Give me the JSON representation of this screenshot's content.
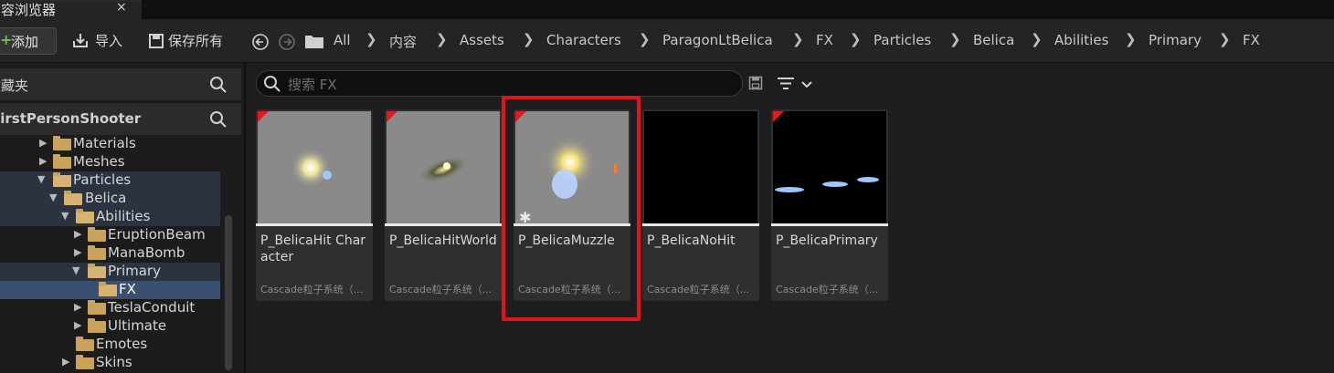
{
  "tab": {
    "title": "内容浏览器",
    "close": "×"
  },
  "toolbar": {
    "add_label": "添加",
    "import_label": "导入",
    "save_all_label": "保存所有"
  },
  "breadcrumbs": [
    "All",
    "内容",
    "Assets",
    "Characters",
    "ParagonLtBelica",
    "FX",
    "Particles",
    "Belica",
    "Abilities",
    "Primary",
    "FX"
  ],
  "left_panel": {
    "favorites_label": "收藏夹",
    "project_label": "FirstPersonShooter",
    "tree": [
      {
        "label": "Materials",
        "state": "collapsed"
      },
      {
        "label": "Meshes",
        "state": "collapsed"
      },
      {
        "label": "Particles",
        "state": "expanded"
      },
      {
        "label": "Belica",
        "state": "expanded"
      },
      {
        "label": "Abilities",
        "state": "expanded"
      },
      {
        "label": "EruptionBeam",
        "state": "collapsed"
      },
      {
        "label": "ManaBomb",
        "state": "collapsed"
      },
      {
        "label": "Primary",
        "state": "expanded"
      },
      {
        "label": "FX",
        "state": "selected"
      },
      {
        "label": "TeslaConduit",
        "state": "collapsed"
      },
      {
        "label": "Ultimate",
        "state": "collapsed"
      },
      {
        "label": "Emotes",
        "state": "leaf"
      },
      {
        "label": "Skins",
        "state": "collapsed"
      }
    ]
  },
  "search": {
    "placeholder": "搜索 FX"
  },
  "assets": [
    {
      "name": "P_BelicaHit Character",
      "type": "Cascade粒子系统（..."
    },
    {
      "name": "P_BelicaHitWorld",
      "type": "Cascade粒子系统（..."
    },
    {
      "name": "P_BelicaMuzzle",
      "type": "Cascade粒子系统（..."
    },
    {
      "name": "P_BelicaNoHit",
      "type": "Cascade粒子系统（..."
    },
    {
      "name": "P_BelicaPrimary",
      "type": "Cascade粒子系统（..."
    }
  ],
  "colors": {
    "highlight": "#e0141c",
    "selection": "#3b5070",
    "folder": "#c9a25c",
    "add_plus": "#6ec14a"
  }
}
